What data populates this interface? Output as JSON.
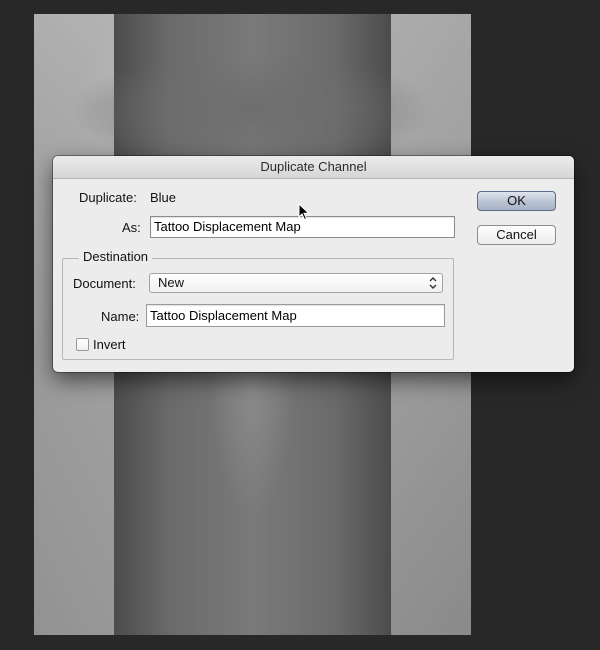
{
  "dialog": {
    "title": "Duplicate Channel",
    "duplicate_label": "Duplicate:",
    "duplicate_value": "Blue",
    "as_label": "As:",
    "as_value": "Tattoo Displacement Map",
    "destination": {
      "legend": "Destination",
      "document_label": "Document:",
      "document_value": "New",
      "name_label": "Name:",
      "name_value": "Tattoo Displacement Map",
      "invert_label": "Invert",
      "invert_checked": false
    },
    "ok_label": "OK",
    "cancel_label": "Cancel"
  },
  "colors": {
    "app_background": "#282828",
    "dialog_background": "#ececec",
    "default_button": "#b9c3d3"
  },
  "icons": {
    "select_arrows": "up-down-chevron-icon",
    "cursor": "mouse-pointer-icon"
  }
}
